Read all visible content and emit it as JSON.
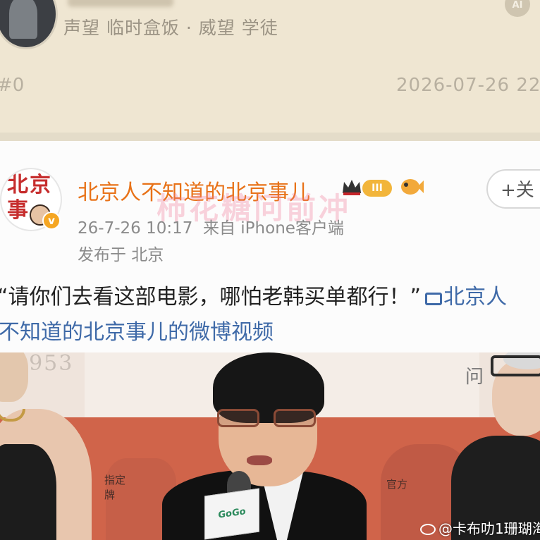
{
  "forum": {
    "ranks": "声望 临时盒饭 · 威望 学徒",
    "ai_label": "AI",
    "floor": "#0",
    "timestamp": "2026-07-26 22"
  },
  "weibo": {
    "account_name": "北京人不知道的北京事儿",
    "logo_chars": [
      "北",
      "京",
      "事"
    ],
    "level_badge": "III",
    "verified_badge": "v",
    "follow_label": "+关",
    "post_time": "26-7-26 10:17",
    "source": "来自 iPhone客户端",
    "location": "发布于 北京",
    "post_text": "“请你们去看这部电影，哪怕老韩买单都行！”",
    "post_link_head": "北京人",
    "post_link_tail": "不知道的北京事儿的微博视频",
    "watermark": "柿花糖问前冲"
  },
  "video": {
    "year_text": "1953",
    "sign_left": "指定\n牌",
    "sign_right": "官方",
    "sign_top": "问",
    "mic_label": "GoGo"
  },
  "credit": "@卡布叻1珊瑚海",
  "colors": {
    "accent_orange": "#e87218",
    "link_blue": "#3f6aa8",
    "forum_bg": "#efe6d2",
    "red_wall": "#d0644a"
  }
}
